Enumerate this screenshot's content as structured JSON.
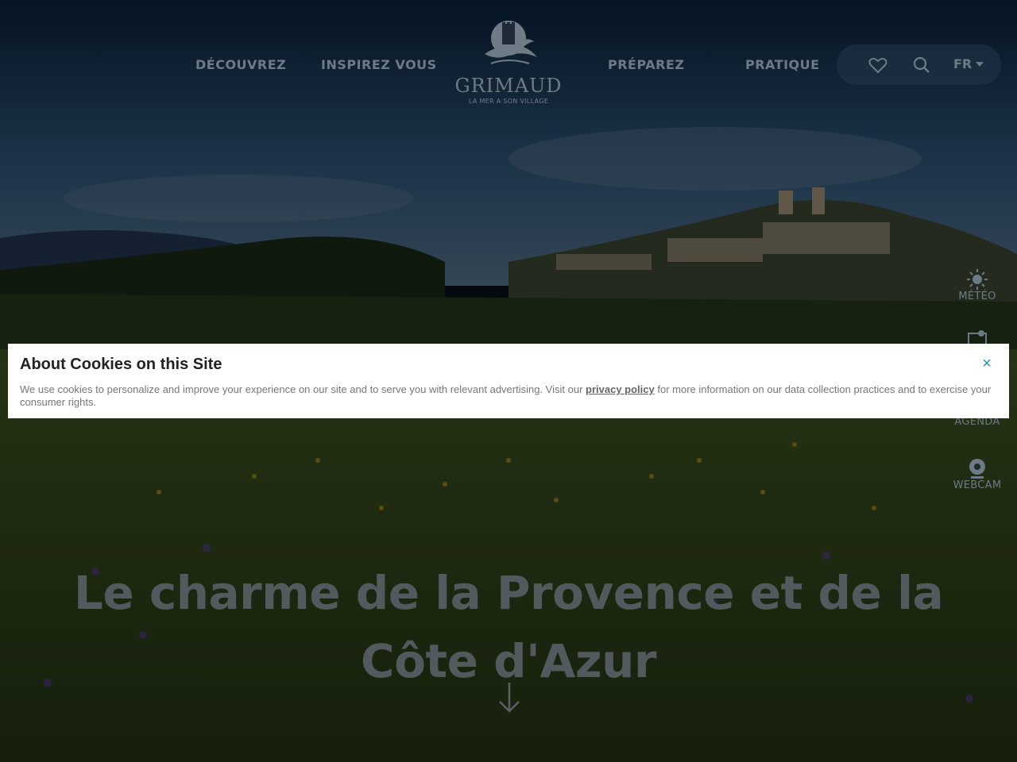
{
  "nav": {
    "items": [
      {
        "label": "DÉCOUVREZ"
      },
      {
        "label": "INSPIREZ VOUS"
      },
      {
        "label": "PRÉPAREZ"
      },
      {
        "label": "PRATIQUE"
      }
    ]
  },
  "logo": {
    "name": "GRIMAUD",
    "tagline": "LA MER A SON VILLAGE"
  },
  "tools": {
    "favorites_icon": "heart-icon",
    "search_icon": "search-icon",
    "language": "FR"
  },
  "side_widgets": [
    {
      "label": "MÉTÉO",
      "icon": "sun-icon"
    },
    {
      "label": "",
      "icon": "map-icon"
    },
    {
      "label": "AGENDA",
      "icon": "calendar-icon"
    },
    {
      "label": "WEBCAM",
      "icon": "webcam-icon"
    }
  ],
  "hero": {
    "title": "Le charme de la Provence et de la Côte d'Azur"
  },
  "cookie_banner": {
    "title": "About Cookies on this Site",
    "text_before": "We use cookies to personalize and improve your experience on our site and to serve you with relevant advertising. Visit our ",
    "link": "privacy policy",
    "text_after": " for more information on our data collection practices and to exercise your consumer rights.",
    "close": "×"
  },
  "colors": {
    "accent": "#2a8fb0",
    "nav_text": "#6d7b86",
    "banner_bg": "#ffffff"
  }
}
